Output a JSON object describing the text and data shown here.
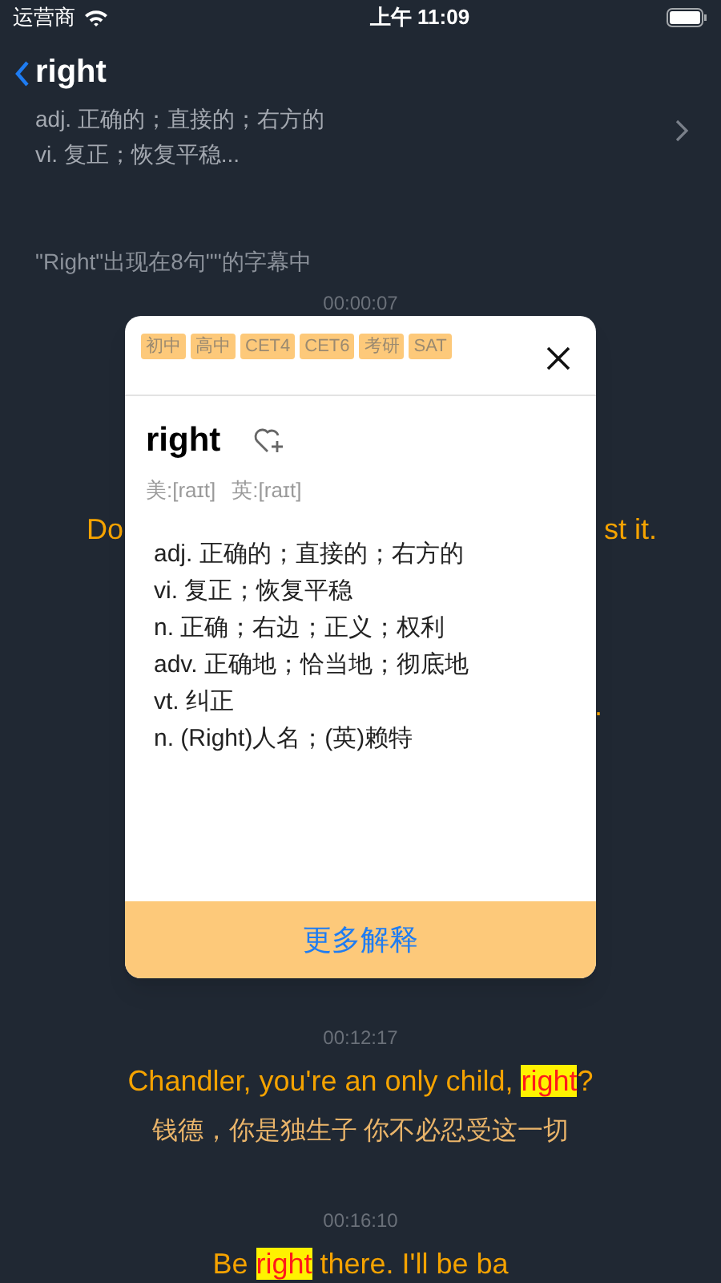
{
  "status_bar": {
    "carrier": "运营商",
    "time": "上午 11:09"
  },
  "word_header": {
    "word": "right",
    "definitions": [
      "adj. 正确的；直接的；右方的",
      "vi. 复正；恢复平稳..."
    ]
  },
  "occurrence_note": "\"Right\"出现在8句\"\"的字幕中",
  "subtitles": [
    {
      "time": "00:00:07",
      "kind": "covered",
      "fragments": [
        "Do",
        "st it.",
        "."
      ]
    },
    {
      "time": "00:12:17",
      "kind": "full",
      "parts": [
        {
          "text": "Chandler, you're an only child, ",
          "highlight": false
        },
        {
          "text": "right",
          "highlight": true
        },
        {
          "text": "?",
          "highlight": false
        }
      ],
      "translation": "钱德，你是独生子 你不必忍受这一切"
    },
    {
      "time": "00:16:10",
      "kind": "full",
      "parts": [
        {
          "text": "Be ",
          "highlight": false
        },
        {
          "text": "right",
          "highlight": true
        },
        {
          "text": " there. I'll be ba",
          "highlight": false
        }
      ]
    }
  ],
  "popup": {
    "tags": [
      "初中",
      "高中",
      "CET4",
      "CET6",
      "考研",
      "SAT"
    ],
    "word": "right",
    "phonetics": [
      "美:[raɪt]",
      "英:[raɪt]"
    ],
    "definitions": [
      "adj. 正确的；直接的；右方的",
      "vi. 复正；恢复平稳",
      "n. 正确；右边；正义；权利",
      "adv. 正确地；恰当地；彻底地",
      "vt. 纠正",
      "n. (Right)人名；(英)赖特"
    ],
    "more_button": "更多解释"
  }
}
